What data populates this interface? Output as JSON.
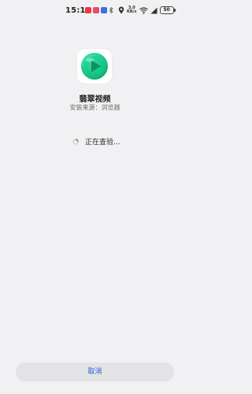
{
  "status_bar": {
    "time": "15:11",
    "net_speed_value": "3.0",
    "net_speed_unit": "KB/s",
    "battery": "50",
    "notification_icons": [
      {
        "name": "app-notification-icon",
        "color": "#e83a3a"
      },
      {
        "name": "app-notification-icon",
        "color": "#e64d6a"
      },
      {
        "name": "app-notification-icon",
        "color": "#3b6fe0"
      }
    ]
  },
  "app": {
    "name": "翡翠视频",
    "install_source": "安装来源：浏览器",
    "icon": "play-icon",
    "icon_colors": {
      "outer": "#1fd391",
      "inner": "#0ebf7d",
      "play": "#17a86c"
    }
  },
  "status": {
    "checking_text": "正在查验..."
  },
  "footer": {
    "cancel_label": "取消",
    "accent": "#1f5fd4"
  }
}
